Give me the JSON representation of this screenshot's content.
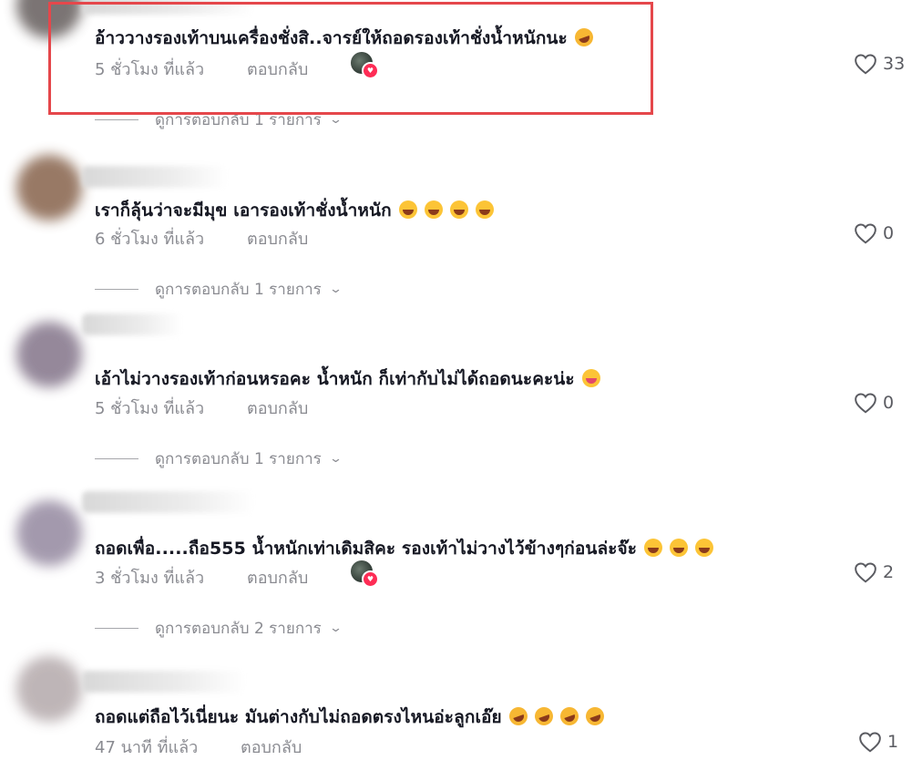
{
  "comments": [
    {
      "text": "อ้าววางรองเท้าบนเครื่องชั่งสิ..จารย์ให้ถอดรองเท้าชั่งน้ำหนักนะ",
      "emojis": [
        "rolling-on-floor-laughing"
      ],
      "time": "5 ชั่วโมง ที่แล้ว",
      "reply_label": "ตอบกลับ",
      "creator_liked": true,
      "likes": "33",
      "view_replies": "ดูการตอบกลับ 1 รายการ"
    },
    {
      "text": "เราก็ลุ้นว่าจะมีมุข เอารองเท้าชั่งน้ำหนัก",
      "emojis": [
        "sweat-smile",
        "sweat-smile",
        "sweat-smile",
        "sweat-smile"
      ],
      "time": "6 ชั่วโมง ที่แล้ว",
      "reply_label": "ตอบกลับ",
      "creator_liked": false,
      "likes": "0",
      "view_replies": "ดูการตอบกลับ 1 รายการ"
    },
    {
      "text": "เอ้าไม่วางรองเท้าก่อนหรอคะ น้ำหนัก ก็เท่ากับไม่ได้ถอดนะคะน่ะ",
      "emojis": [
        "face-with-tongue"
      ],
      "time": "5 ชั่วโมง ที่แล้ว",
      "reply_label": "ตอบกลับ",
      "creator_liked": false,
      "likes": "0",
      "view_replies": "ดูการตอบกลับ 1 รายการ"
    },
    {
      "text": "ถอดเพื่อ.....ถือ555 น้ำหนักเท่าเดิมสิคะ รองเท้าไม่วางไว้ข้างๆก่อนล่ะจ๊ะ",
      "emojis": [
        "joy",
        "joy",
        "joy"
      ],
      "time": "3 ชั่วโมง ที่แล้ว",
      "reply_label": "ตอบกลับ",
      "creator_liked": true,
      "likes": "2",
      "view_replies": "ดูการตอบกลับ 2 รายการ"
    },
    {
      "text": "ถอดแต่ถือไว้เนี่ยนะ มันต่างกับไม่ถอดตรงไหนอ่ะลูกเอ๊ย",
      "emojis": [
        "rolling-on-floor-laughing",
        "rolling-on-floor-laughing",
        "rolling-on-floor-laughing",
        "rolling-on-floor-laughing"
      ],
      "time": "47 นาที ที่แล้ว",
      "reply_label": "ตอบกลับ",
      "creator_liked": false,
      "likes": "1"
    }
  ],
  "colors": {
    "highlight_border": "#e5474b",
    "creator_heart": "#fe2c55",
    "meta_text": "#8a8b91"
  }
}
